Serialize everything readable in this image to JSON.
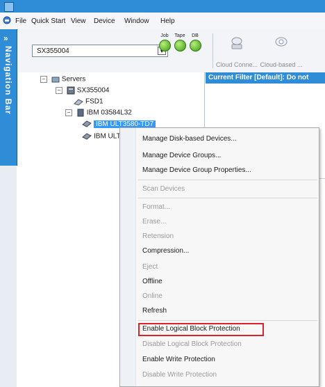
{
  "menubar": {
    "items": [
      "File",
      "Quick Start",
      "View",
      "Device",
      "Window",
      "Help"
    ]
  },
  "navigation": {
    "chevron": "»",
    "label": "Navigation Bar"
  },
  "toolbar": {
    "device_select_value": "SX355004",
    "indicators": [
      "Job",
      "Tape",
      "DB"
    ],
    "cloud_buttons": [
      "Cloud Conne...",
      "Cloud-based ..."
    ]
  },
  "tree": {
    "root": "Servers",
    "server": "SX355004",
    "fsd": "FSD1",
    "library": "IBM 03584L32",
    "drive_selected": "IBM ULT3580-TD7",
    "drive2": "IBM ULT3580-TD7"
  },
  "right_panel": {
    "header": "Current Filter [Default]:  Do not"
  },
  "context_menu": {
    "items": [
      {
        "label": "Manage Disk-based Devices...",
        "enabled": true
      },
      {
        "label": "Manage Device Groups...",
        "enabled": true
      },
      {
        "label": "Manage Device Group Properties...",
        "enabled": true
      },
      {
        "label": "Scan Devices",
        "enabled": false
      },
      {
        "label": "Format...",
        "enabled": false
      },
      {
        "label": "Erase...",
        "enabled": false
      },
      {
        "label": "Retension",
        "enabled": false
      },
      {
        "label": "Compression...",
        "enabled": true
      },
      {
        "label": "Eject",
        "enabled": false
      },
      {
        "label": "Offline",
        "enabled": true
      },
      {
        "label": "Online",
        "enabled": false
      },
      {
        "label": "Refresh",
        "enabled": true
      },
      {
        "label": "Enable Logical Block Protection",
        "enabled": true
      },
      {
        "label": "Disable Logical Block Protection",
        "enabled": false
      },
      {
        "label": "Enable Write Protection",
        "enabled": true
      },
      {
        "label": "Disable Write Protection",
        "enabled": false
      }
    ]
  },
  "colors": {
    "accent": "#2f8dd8",
    "selection": "#3399ff",
    "highlight_box": "#d9232b"
  }
}
